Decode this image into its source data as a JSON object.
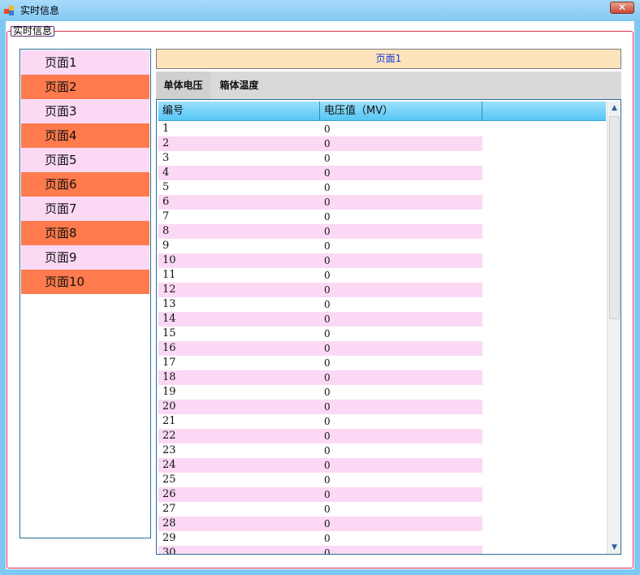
{
  "window": {
    "title": "实时信息",
    "close_label": "✕"
  },
  "group": {
    "legend": "实时信息"
  },
  "nav": {
    "items": [
      "页面1",
      "页面2",
      "页面3",
      "页面4",
      "页面5",
      "页面6",
      "页面7",
      "页面8",
      "页面9",
      "页面10"
    ]
  },
  "page_header": "页面1",
  "tabs": [
    {
      "label": "单体电压",
      "active": true
    },
    {
      "label": "箱体温度",
      "active": false
    }
  ],
  "grid": {
    "columns": [
      "编号",
      "电压值（MV）",
      ""
    ],
    "rows": [
      [
        "1",
        "0"
      ],
      [
        "2",
        "0"
      ],
      [
        "3",
        "0"
      ],
      [
        "4",
        "0"
      ],
      [
        "5",
        "0"
      ],
      [
        "6",
        "0"
      ],
      [
        "7",
        "0"
      ],
      [
        "8",
        "0"
      ],
      [
        "9",
        "0"
      ],
      [
        "10",
        "0"
      ],
      [
        "11",
        "0"
      ],
      [
        "12",
        "0"
      ],
      [
        "13",
        "0"
      ],
      [
        "14",
        "0"
      ],
      [
        "15",
        "0"
      ],
      [
        "16",
        "0"
      ],
      [
        "17",
        "0"
      ],
      [
        "18",
        "0"
      ],
      [
        "19",
        "0"
      ],
      [
        "20",
        "0"
      ],
      [
        "21",
        "0"
      ],
      [
        "22",
        "0"
      ],
      [
        "23",
        "0"
      ],
      [
        "24",
        "0"
      ],
      [
        "25",
        "0"
      ],
      [
        "26",
        "0"
      ],
      [
        "27",
        "0"
      ],
      [
        "28",
        "0"
      ],
      [
        "29",
        "0"
      ],
      [
        "30",
        "0"
      ]
    ]
  },
  "colors": {
    "nav_odd": "#fbd9f5",
    "nav_even": "#ff7a4c",
    "row_alt": "#fbd9f5",
    "header_bg": "#fde3bb",
    "header_text": "#1a3bd8",
    "group_border": "#e0304a"
  },
  "icons": {
    "app": "app-window-icon",
    "close": "close-icon",
    "scroll_up": "scroll-up-arrow-icon",
    "scroll_down": "scroll-down-arrow-icon"
  }
}
